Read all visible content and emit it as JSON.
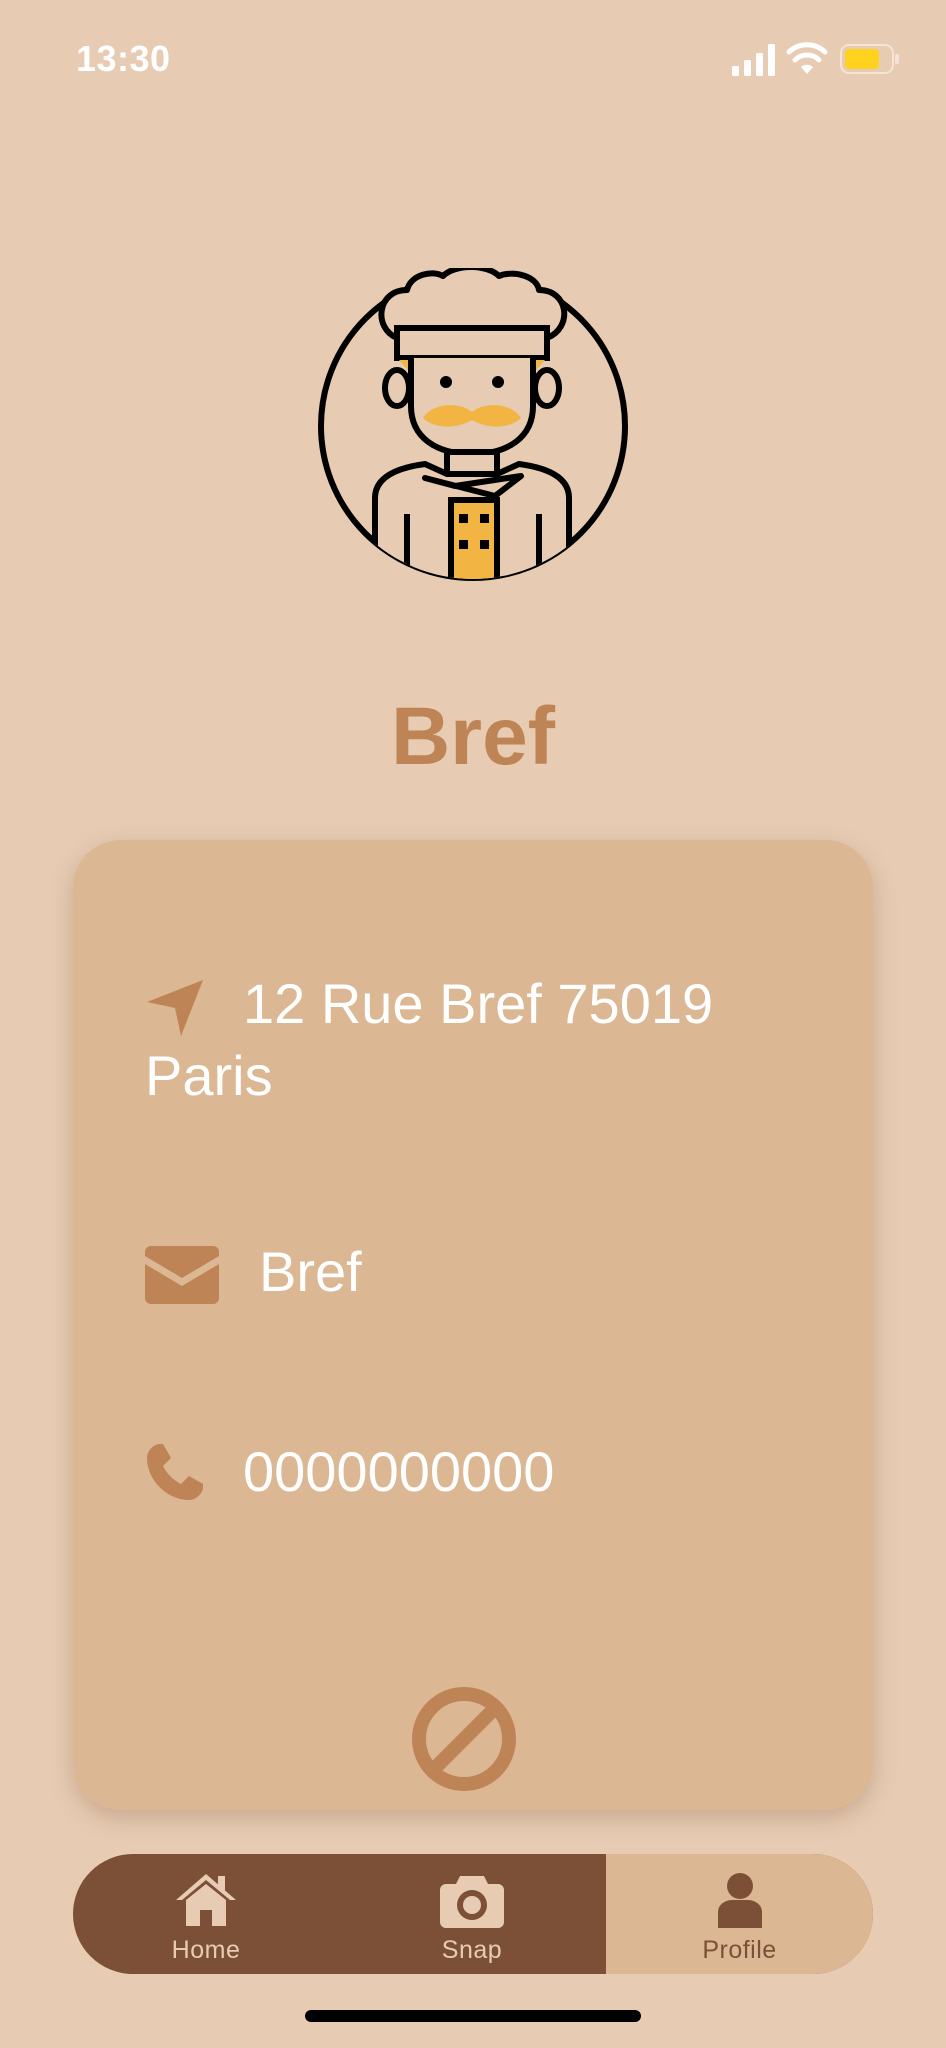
{
  "status_bar": {
    "time": "13:30",
    "icons": [
      "signal-icon",
      "wifi-icon",
      "battery-icon"
    ]
  },
  "profile": {
    "avatar_icon": "chef-avatar-icon",
    "name": "Bref"
  },
  "info_card": {
    "address": "12 Rue  Bref  75019 Paris",
    "address_icon": "location-arrow-icon",
    "email": "Bref",
    "email_icon": "envelope-icon",
    "phone": "0000000000",
    "phone_icon": "phone-icon",
    "action_icon": "block-icon"
  },
  "tab_bar": {
    "tabs": [
      {
        "label": "Home",
        "icon": "home-icon"
      },
      {
        "label": "Snap",
        "icon": "camera-icon"
      },
      {
        "label": "Profile",
        "icon": "user-icon"
      }
    ],
    "selected": "Profile"
  },
  "colors": {
    "background": "#E7CCB3",
    "card": "#DCB793",
    "accent": "#BE8456",
    "tab_dark": "#7C5037",
    "text_light": "#FFFFFF"
  }
}
